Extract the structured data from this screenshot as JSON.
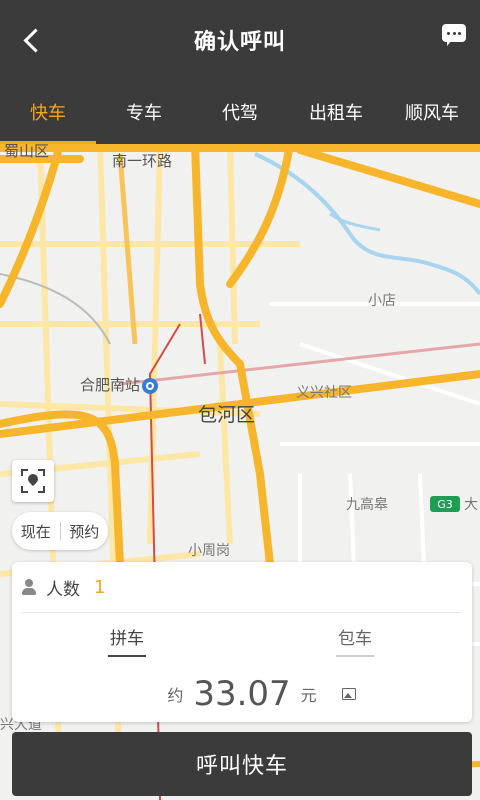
{
  "header": {
    "title": "确认呼叫",
    "back_icon": "back-arrow-icon",
    "message_icon": "chat-bubble-icon"
  },
  "tabs": [
    {
      "label": "快车",
      "active": true
    },
    {
      "label": "专车",
      "active": false
    },
    {
      "label": "代驾",
      "active": false
    },
    {
      "label": "出租车",
      "active": false
    },
    {
      "label": "顺风车",
      "active": false
    }
  ],
  "map": {
    "labels": {
      "district_top": "蜀山区",
      "ring_road": "南一环路",
      "xiaodian": "小店",
      "station": "合肥南站",
      "baohe": "包河区",
      "yixing": "义兴社区",
      "jiugaofu": "九高皋",
      "da": "大",
      "xiaozhougang": "小周岗",
      "xingdadao": "兴大道"
    },
    "highway_badge": "G3",
    "time_toggle": {
      "now": "现在",
      "reserve": "预约"
    }
  },
  "card": {
    "people_label": "人数",
    "people_count": "1",
    "mode_carpool": "拼车",
    "mode_charter": "包车",
    "price_prefix": "约",
    "price_value": "33.07",
    "price_unit": "元"
  },
  "call_button": {
    "label": "呼叫快车"
  },
  "colors": {
    "header_bg": "#3b3b3b",
    "accent": "#f5a623",
    "road_major": "#f7b52b",
    "road_minor": "#fde7a6"
  }
}
